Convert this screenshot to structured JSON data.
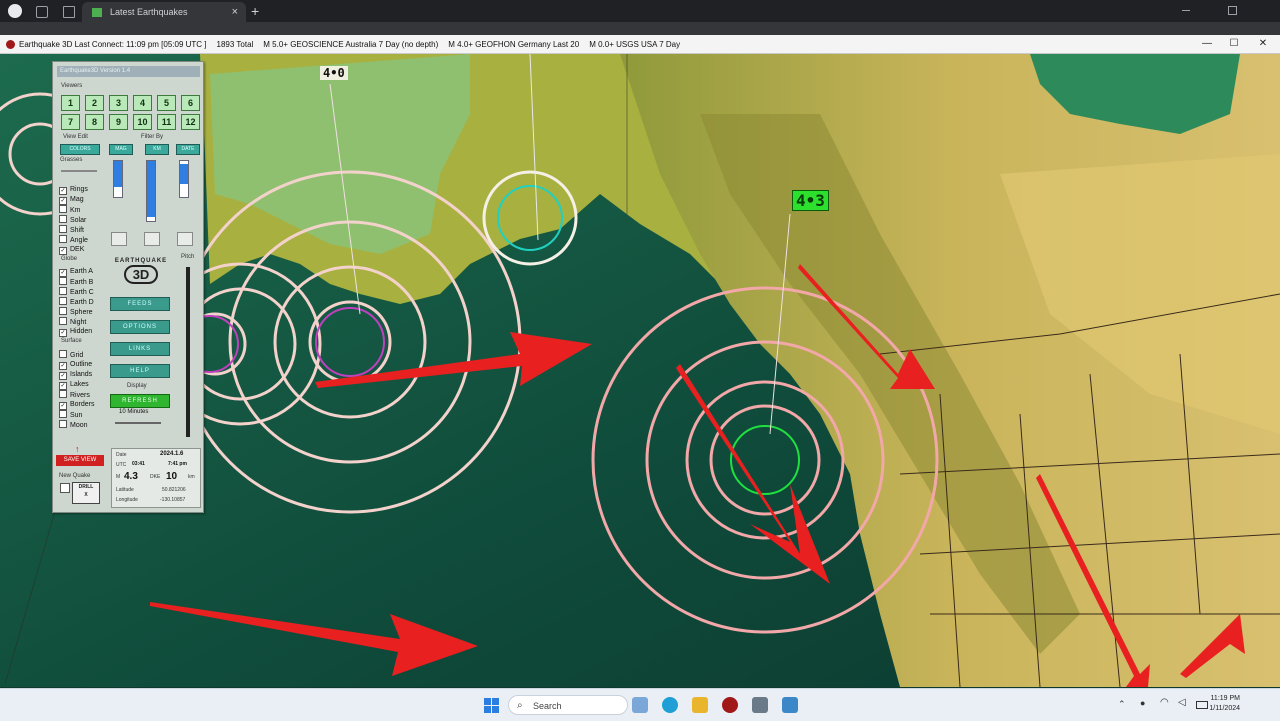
{
  "browser": {
    "tab_title": "Latest Earthquakes",
    "new_tab": "+",
    "close_tab": "×"
  },
  "window": {
    "title": "Earthquake 3D  Last Connect: 11:09 pm  [05:09 UTC ]",
    "total": "1893  Total",
    "feed1": "M 5.0+  GEOSCIENCE Australia 7 Day (no depth)",
    "feed2": "M 4.0+  GEOFHON Germany Last 20",
    "feed3": "M 0.0+  USGS USA 7 Day",
    "minimize": "—",
    "maximize": "☐",
    "close": "✕"
  },
  "map": {
    "label_left": "4•0",
    "label_right": "4•3"
  },
  "panel": {
    "title": "Earthquake3D  Version 1.4",
    "viewers_label": "Viewers",
    "viewers": [
      "1",
      "2",
      "3",
      "4",
      "5",
      "6",
      "7",
      "8",
      "9",
      "10",
      "11",
      "12"
    ],
    "view_edit_label": "View Edit",
    "filter_by_label": "Filter By",
    "edit_buttons": [
      "COLORS",
      "MAG",
      "KM",
      "DATE"
    ],
    "grasses_label": "Grasses",
    "overlays": [
      {
        "label": "Rings",
        "checked": true
      },
      {
        "label": "Mag",
        "checked": true
      },
      {
        "label": "Km",
        "checked": false
      },
      {
        "label": "Solar",
        "checked": false
      },
      {
        "label": "Shift",
        "checked": false
      },
      {
        "label": "Angle",
        "checked": false
      },
      {
        "label": "DEK",
        "checked": true
      }
    ],
    "globe_label": "Globe",
    "globes": [
      {
        "label": "Earth A",
        "checked": true
      },
      {
        "label": "Earth B",
        "checked": false
      },
      {
        "label": "Earth C",
        "checked": false
      },
      {
        "label": "Earth D",
        "checked": false
      },
      {
        "label": "Sphere",
        "checked": false
      },
      {
        "label": "Night",
        "checked": false
      },
      {
        "label": "Hidden",
        "checked": true
      }
    ],
    "surface_label": "Surface",
    "surfaces": [
      {
        "label": "Grid",
        "checked": false
      },
      {
        "label": "Outline",
        "checked": true
      },
      {
        "label": "Islands",
        "checked": true
      },
      {
        "label": "Lakes",
        "checked": true
      },
      {
        "label": "Rivers",
        "checked": false
      },
      {
        "label": "Borders",
        "checked": true
      },
      {
        "label": "Sun",
        "checked": false
      },
      {
        "label": "Moon",
        "checked": false
      }
    ],
    "pitch_label": "Pitch",
    "logo_line1": "EARTHQUAKE",
    "logo_line2": "3D",
    "tool_buttons": [
      "FEEDS",
      "OPTIONS",
      "LINKS",
      "HELP"
    ],
    "display_label": "Display",
    "refresh": "REFRESH",
    "interval": "10 Minutes",
    "save_view": "SAVE VIEW",
    "new_quake": "New Quake",
    "drill": "DRILL",
    "drill2": "X",
    "info": {
      "date_label": "Date",
      "date": "2024.1.6",
      "utc_label": "UTC",
      "utc": "03:41",
      "local": "7:41 pm",
      "mag_label": "M",
      "mag": "4.3",
      "depth_label": "DKE",
      "depth": "10",
      "depth_unit": "km",
      "lat_label": "Latitude",
      "lat": "50.821206",
      "lon_label": "Longitude",
      "lon": "-130.10857"
    }
  },
  "taskbar": {
    "search": "Search",
    "time": "11:19 PM",
    "date": "1/11/2024"
  }
}
